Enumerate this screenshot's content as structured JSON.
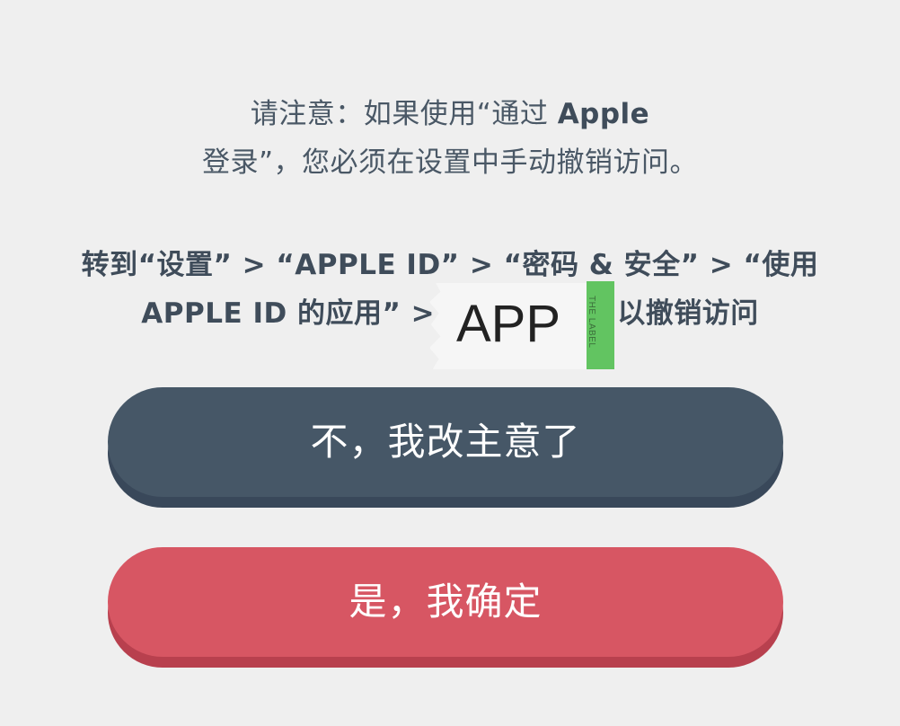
{
  "notice": {
    "line1_a": "请注意：如果使用“通过 ",
    "line1_b": "Apple",
    "line2": "登录”，您必须在设置中手动撤销访问。"
  },
  "instructions": {
    "l1_a": "转到“设置” > “APPLE ID” > “密码 & 安全” > “使用",
    "l2_a": "APPLE ID",
    "l2_b": " 的应用” > “",
    "l2_c": "”以撤销访问"
  },
  "overlay": {
    "sticker_text": "APP",
    "tab_text": "THE LABEL"
  },
  "buttons": {
    "no": "不，我改主意了",
    "yes": "是，我确定"
  },
  "colors": {
    "background": "#efefef",
    "text": "#4a5866",
    "button_no": "#465767",
    "button_yes": "#d75663",
    "tab_green": "#62c461"
  }
}
